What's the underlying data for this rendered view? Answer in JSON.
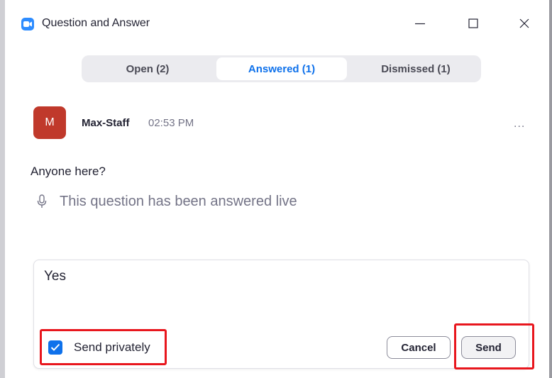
{
  "window": {
    "title": "Question and Answer"
  },
  "tabs": [
    {
      "label": "Open (2)",
      "active": false
    },
    {
      "label": "Answered (1)",
      "active": true
    },
    {
      "label": "Dismissed (1)",
      "active": false
    }
  ],
  "question": {
    "avatar_initial": "M",
    "author": "Max-Staff",
    "time": "02:53 PM",
    "more": "...",
    "text": "Anyone here?",
    "status": "This question has been answered live"
  },
  "reply": {
    "text": "Yes",
    "send_privately_label": "Send privately",
    "send_privately_checked": true,
    "cancel_label": "Cancel",
    "send_label": "Send"
  },
  "colors": {
    "accent": "#0e71eb",
    "avatar": "#c0392b",
    "highlight": "#e8161d"
  },
  "icons": [
    "zoom-app-icon",
    "minimize-icon",
    "maximize-icon",
    "close-icon",
    "more-icon",
    "microphone-icon",
    "checkmark-icon"
  ]
}
